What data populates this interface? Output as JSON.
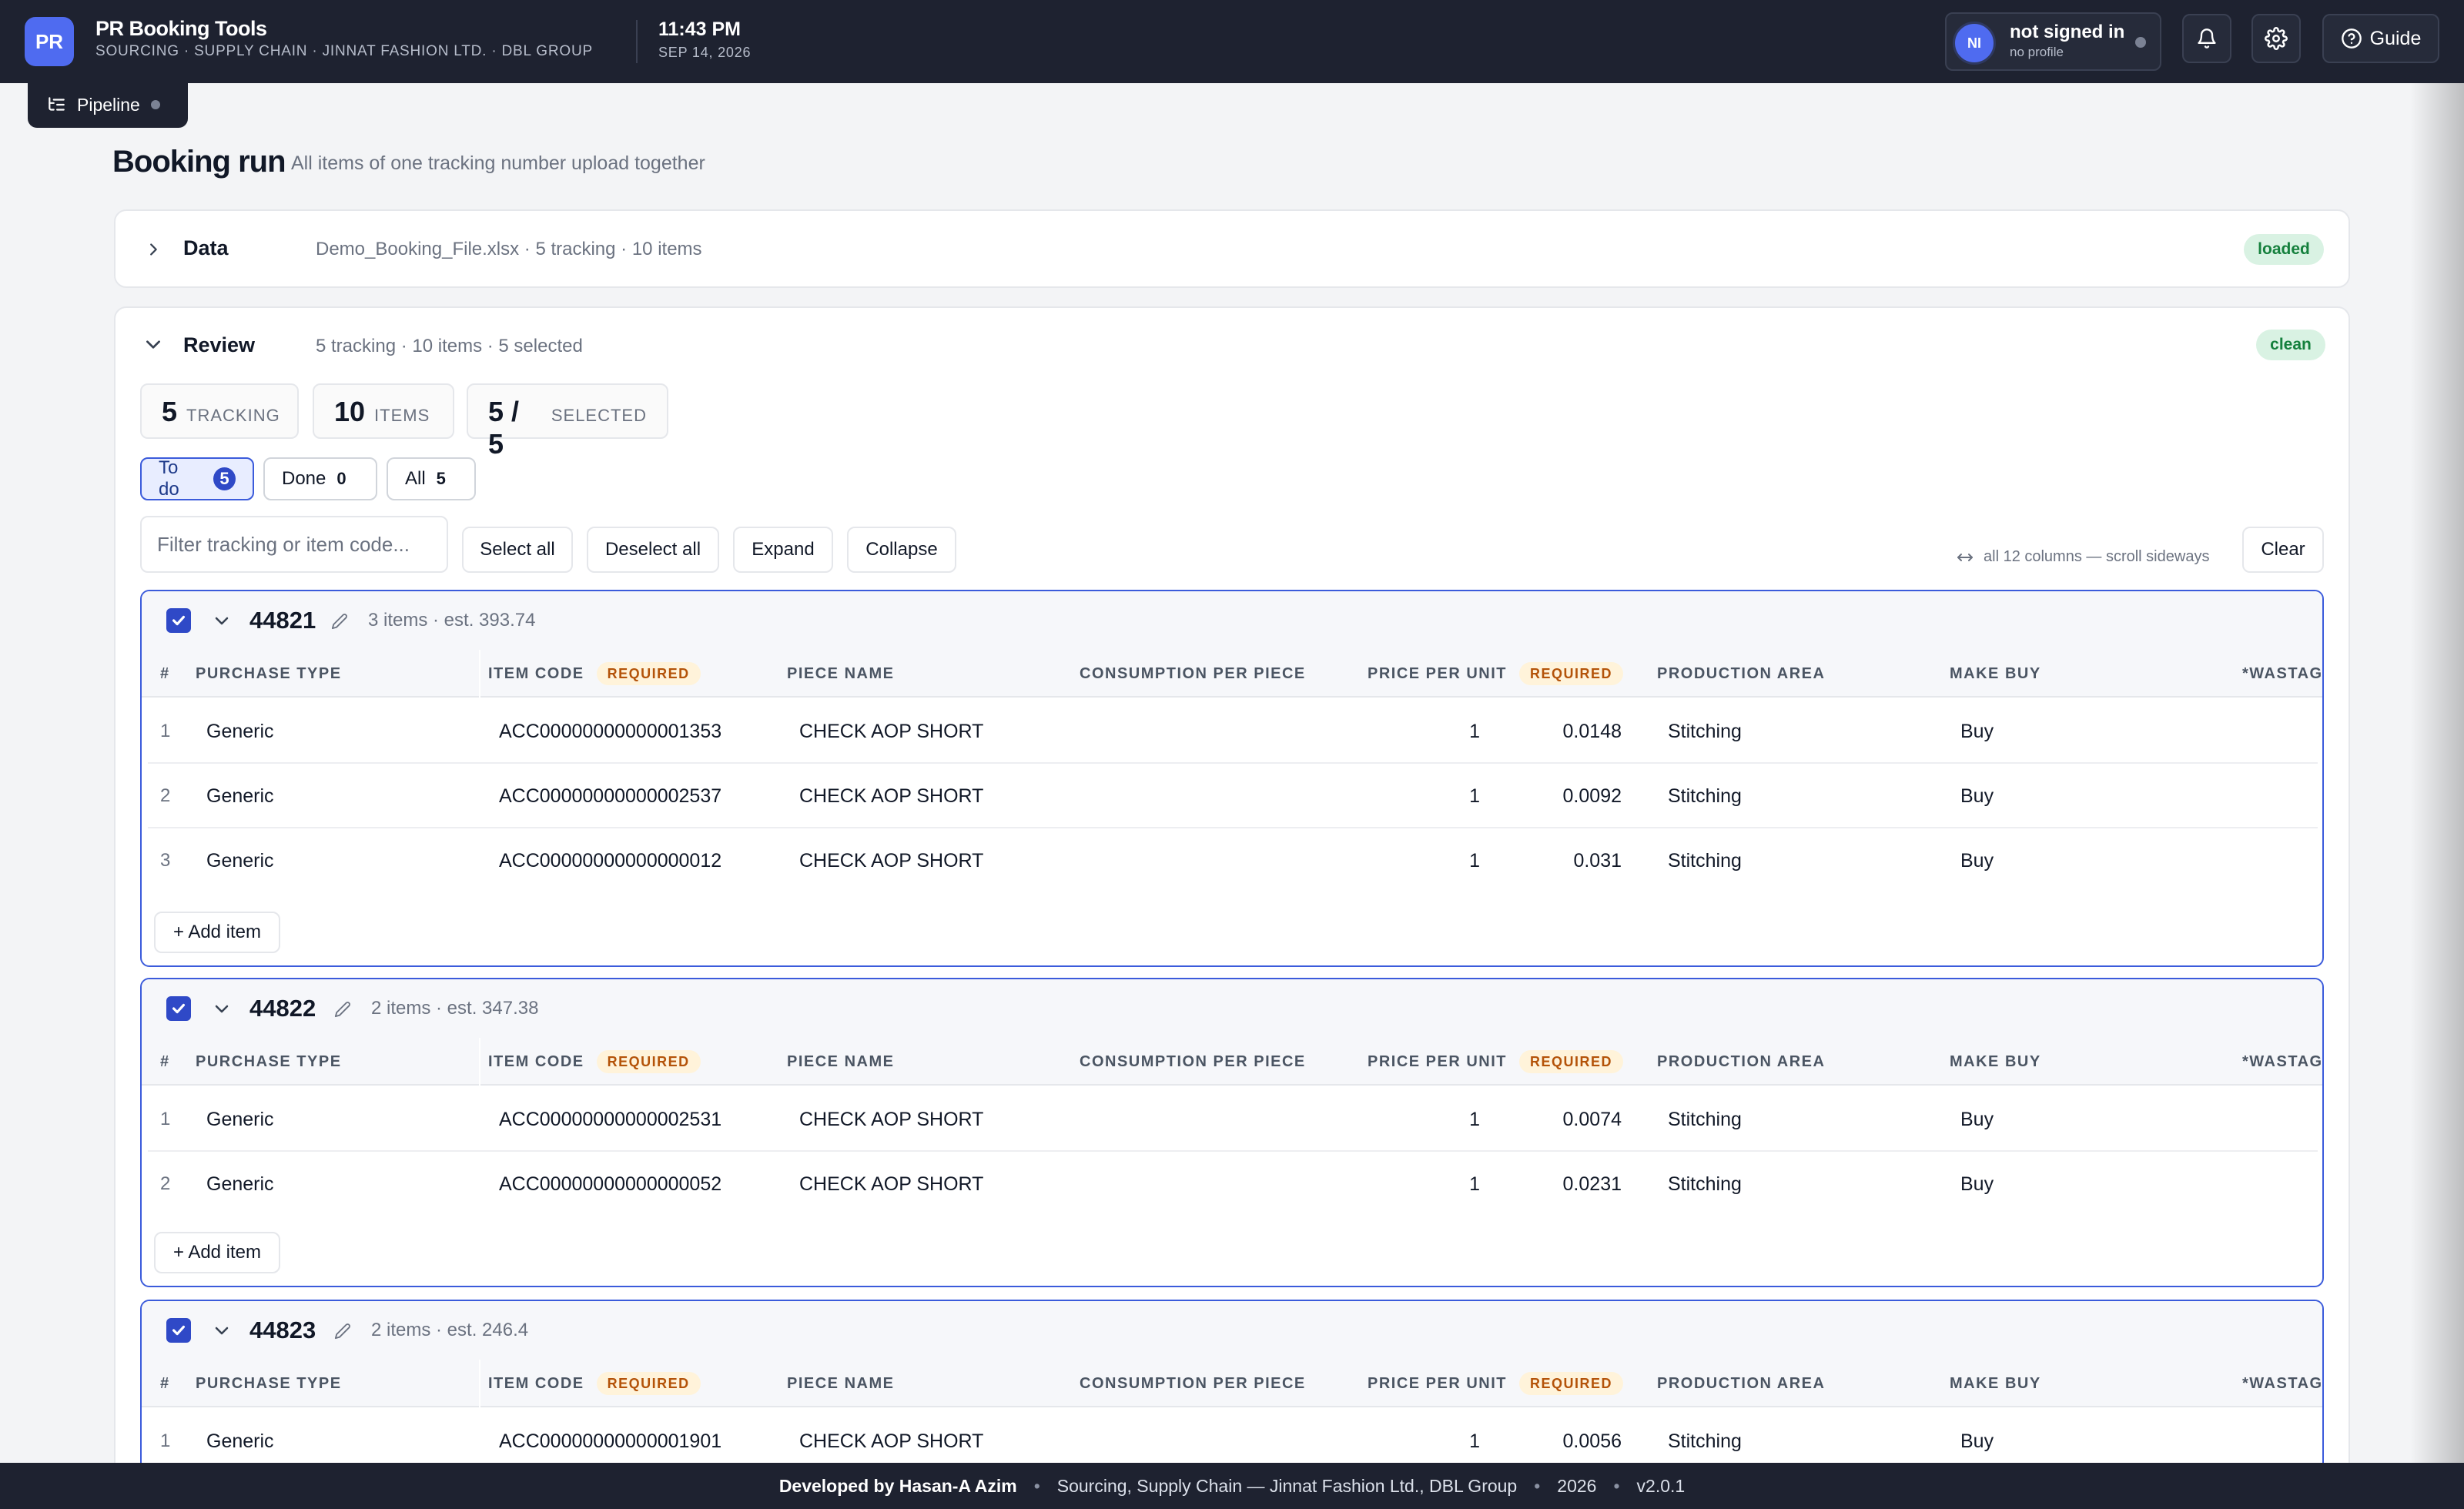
{
  "app": {
    "logo": "PR",
    "name": "PR Booking Tools",
    "subtitle": "SOURCING · SUPPLY CHAIN · JINNAT FASHION LTD. · DBL GROUP",
    "time": "11:43 PM",
    "date": "SEP 14, 2026"
  },
  "user": {
    "initials": "NI",
    "name": "not signed in",
    "profile": "no profile"
  },
  "header": {
    "guide_label": "Guide"
  },
  "pipeline": {
    "label": "Pipeline"
  },
  "page": {
    "title": "Booking run",
    "subtitle": "All items of one tracking number upload together"
  },
  "data_section": {
    "label": "Data",
    "summary": "Demo_Booking_File.xlsx · 5 tracking · 10 items",
    "status": "loaded"
  },
  "review_section": {
    "label": "Review",
    "summary": "5 tracking · 10 items · 5 selected",
    "status": "clean"
  },
  "stats": [
    {
      "value": "5",
      "label": "TRACKING"
    },
    {
      "value": "10",
      "label": "ITEMS"
    },
    {
      "value": "5 / 5",
      "label": "SELECTED"
    }
  ],
  "tabs": [
    {
      "label": "To do",
      "count": "5"
    },
    {
      "label": "Done",
      "count": "0"
    },
    {
      "label": "All",
      "count": "5"
    }
  ],
  "toolbar": {
    "filter_placeholder": "Filter tracking or item code...",
    "select_all": "Select all",
    "deselect_all": "Deselect all",
    "expand": "Expand",
    "collapse": "Collapse",
    "hint": "all 12 columns — scroll sideways",
    "clear": "Clear"
  },
  "columns": {
    "index": "#",
    "purchase_type": "PURCHASE TYPE",
    "item_code": "ITEM CODE",
    "piece_name": "PIECE NAME",
    "consumption": "CONSUMPTION PER PIECE",
    "price": "PRICE PER UNIT",
    "production_area": "PRODUCTION AREA",
    "make_buy": "MAKE BUY",
    "wastage": "*WASTAG",
    "required": "REQUIRED"
  },
  "add_item_label": "+ Add item",
  "groups": [
    {
      "tracking": "44821",
      "summary": "3 items · est. 393.74",
      "rows": [
        {
          "index": "1",
          "purchase_type": "Generic",
          "item_code": "ACC00000000000001353",
          "piece_name": "CHECK AOP SHORT",
          "consumption": "1",
          "price": "0.0148",
          "production_area": "Stitching",
          "make_buy": "Buy"
        },
        {
          "index": "2",
          "purchase_type": "Generic",
          "item_code": "ACC00000000000002537",
          "piece_name": "CHECK AOP SHORT",
          "consumption": "1",
          "price": "0.0092",
          "production_area": "Stitching",
          "make_buy": "Buy"
        },
        {
          "index": "3",
          "purchase_type": "Generic",
          "item_code": "ACC00000000000000012",
          "piece_name": "CHECK AOP SHORT",
          "consumption": "1",
          "price": "0.031",
          "production_area": "Stitching",
          "make_buy": "Buy"
        }
      ]
    },
    {
      "tracking": "44822",
      "summary": "2 items · est. 347.38",
      "rows": [
        {
          "index": "1",
          "purchase_type": "Generic",
          "item_code": "ACC00000000000002531",
          "piece_name": "CHECK AOP SHORT",
          "consumption": "1",
          "price": "0.0074",
          "production_area": "Stitching",
          "make_buy": "Buy"
        },
        {
          "index": "2",
          "purchase_type": "Generic",
          "item_code": "ACC00000000000000052",
          "piece_name": "CHECK AOP SHORT",
          "consumption": "1",
          "price": "0.0231",
          "production_area": "Stitching",
          "make_buy": "Buy"
        }
      ]
    },
    {
      "tracking": "44823",
      "summary": "2 items · est. 246.4",
      "rows": [
        {
          "index": "1",
          "purchase_type": "Generic",
          "item_code": "ACC00000000000001901",
          "piece_name": "CHECK AOP SHORT",
          "consumption": "1",
          "price": "0.0056",
          "production_area": "Stitching",
          "make_buy": "Buy"
        }
      ]
    }
  ],
  "footer": {
    "developer": "Developed by Hasan-A Azim",
    "org": "Sourcing, Supply Chain — Jinnat Fashion Ltd., DBL Group",
    "year": "2026",
    "version": "v2.0.1"
  },
  "colors": {
    "accent": "#3b5bdb",
    "topbar": "#1e2230",
    "success_bg": "#d9f2e3",
    "required_bg": "#fff3da"
  }
}
